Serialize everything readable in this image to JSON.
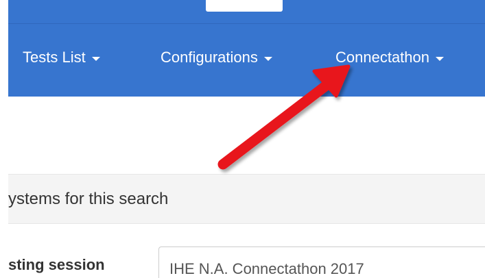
{
  "navbar": {
    "items": [
      {
        "label": "Tests List"
      },
      {
        "label": "Configurations"
      },
      {
        "label": "Connectathon"
      }
    ]
  },
  "search": {
    "summary": "ystems for this search"
  },
  "form": {
    "testing_session_label": "sting session",
    "testing_session_value": "IHE N.A. Connectathon 2017"
  },
  "annotation": {
    "arrow_color": "#e8141c",
    "arrow_target": "Connectathon"
  },
  "colors": {
    "navbar_bg": "#3775cf",
    "navbar_text": "#ffffff",
    "search_bar_bg": "#f4f4f4"
  }
}
